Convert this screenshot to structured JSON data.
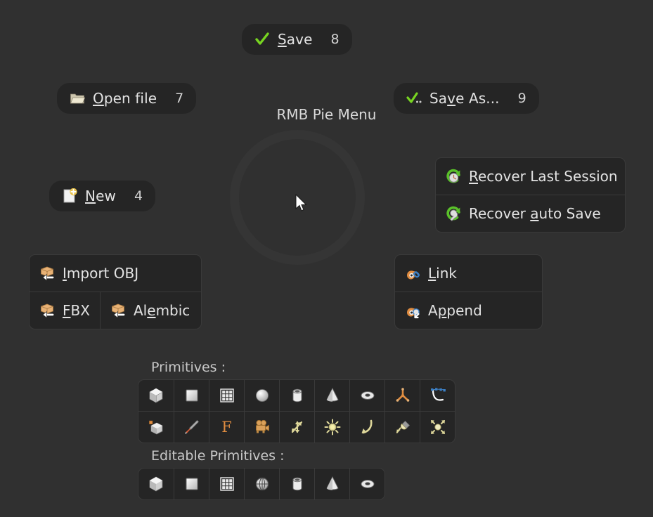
{
  "window": {
    "title": "RMB Pie Menu",
    "background_color": "#303030",
    "button_color": "#252525",
    "border_color": "#3a3a3a",
    "text_color": "#e3e3e3",
    "accent_green": "#77d421",
    "accent_orange": "#e08c40"
  },
  "pie": {
    "center_label": "RMB Pie Menu",
    "cursor_icon": "mouse-cursor-arrow"
  },
  "pie_buttons": [
    {
      "id": "save",
      "label_pre": "",
      "label_accel": "S",
      "label_post": "ave",
      "label": "Save",
      "key": "8",
      "icon": "checkmark-green-icon"
    },
    {
      "id": "open",
      "label_pre": "",
      "label_accel": "O",
      "label_post": "pen file",
      "label": "Open file",
      "key": "7",
      "icon": "folder-open-icon"
    },
    {
      "id": "saveas",
      "label_pre": "Sa",
      "label_accel": "v",
      "label_post": "e As...",
      "label": "Save As...",
      "key": "9",
      "icon": "checkmark-dots-green-icon"
    },
    {
      "id": "new",
      "label_pre": "",
      "label_accel": "N",
      "label_post": "ew",
      "label": "New",
      "key": "4",
      "icon": "new-file-plus-icon"
    }
  ],
  "recover_panel": {
    "items": [
      {
        "id": "recover-last-session",
        "label_pre": "",
        "label_accel": "R",
        "label_post": "ecover Last Session",
        "label": "Recover Last Session",
        "icon": "recover-clock-icon"
      },
      {
        "id": "recover-auto-save",
        "label_pre": "Recover ",
        "label_accel": "a",
        "label_post": "uto Save",
        "label": "Recover auto Save",
        "icon": "recover-wrench-icon"
      }
    ]
  },
  "import_panel": {
    "rows": [
      [
        {
          "id": "import-obj",
          "label_pre": "",
          "label_accel": "I",
          "label_post": "mport OBJ",
          "label": "Import OBJ",
          "icon": "import-box-icon"
        }
      ],
      [
        {
          "id": "import-fbx",
          "label_pre": "",
          "label_accel": "F",
          "label_post": "BX",
          "label": "FBX",
          "icon": "import-box-icon"
        },
        {
          "id": "import-alembic",
          "label_pre": "Al",
          "label_accel": "e",
          "label_post": "mbic",
          "label": "Alembic",
          "icon": "import-box-icon"
        }
      ]
    ]
  },
  "link_panel": {
    "rows": [
      [
        {
          "id": "link",
          "label_pre": "",
          "label_accel": "L",
          "label_post": "ink",
          "label": "Link",
          "icon": "blender-link-icon"
        }
      ],
      [
        {
          "id": "append",
          "label_pre": "A",
          "label_accel": "p",
          "label_post": "pend",
          "label": "Append",
          "icon": "blender-append-icon"
        }
      ]
    ]
  },
  "primitives": {
    "label": "Primitives :",
    "rows": [
      [
        {
          "id": "mesh-cube",
          "icon": "cube-icon"
        },
        {
          "id": "mesh-plane",
          "icon": "plane-icon"
        },
        {
          "id": "mesh-grid",
          "icon": "grid-icon"
        },
        {
          "id": "mesh-sphere",
          "icon": "sphere-icon"
        },
        {
          "id": "mesh-cylinder",
          "icon": "cylinder-icon"
        },
        {
          "id": "mesh-cone",
          "icon": "cone-icon"
        },
        {
          "id": "mesh-torus",
          "icon": "torus-icon"
        },
        {
          "id": "empty-axes",
          "icon": "empty-axes-icon"
        },
        {
          "id": "curve-bezier",
          "icon": "bezier-curve-icon"
        }
      ],
      [
        {
          "id": "object-empty",
          "icon": "object-vertex-cube-icon"
        },
        {
          "id": "grease-pencil",
          "icon": "brush-icon"
        },
        {
          "id": "text-object",
          "icon": "font-f-icon"
        },
        {
          "id": "camera",
          "icon": "camera-icon"
        },
        {
          "id": "empty-arrows",
          "icon": "empty-arrows-icon"
        },
        {
          "id": "light-sun",
          "icon": "sun-light-icon"
        },
        {
          "id": "light-area",
          "icon": "area-light-arc-icon"
        },
        {
          "id": "light-spot",
          "icon": "spot-light-icon"
        },
        {
          "id": "light-point",
          "icon": "point-light-icon"
        }
      ]
    ]
  },
  "editable_primitives": {
    "label": "Editable Primitives :",
    "rows": [
      [
        {
          "id": "edit-cube",
          "icon": "cube-icon"
        },
        {
          "id": "edit-plane",
          "icon": "plane-icon"
        },
        {
          "id": "edit-grid",
          "icon": "grid-icon"
        },
        {
          "id": "edit-uvsphere",
          "icon": "uv-sphere-icon"
        },
        {
          "id": "edit-cylinder",
          "icon": "cylinder-icon"
        },
        {
          "id": "edit-cone",
          "icon": "cone-icon"
        },
        {
          "id": "edit-torus",
          "icon": "torus-icon"
        }
      ]
    ]
  }
}
